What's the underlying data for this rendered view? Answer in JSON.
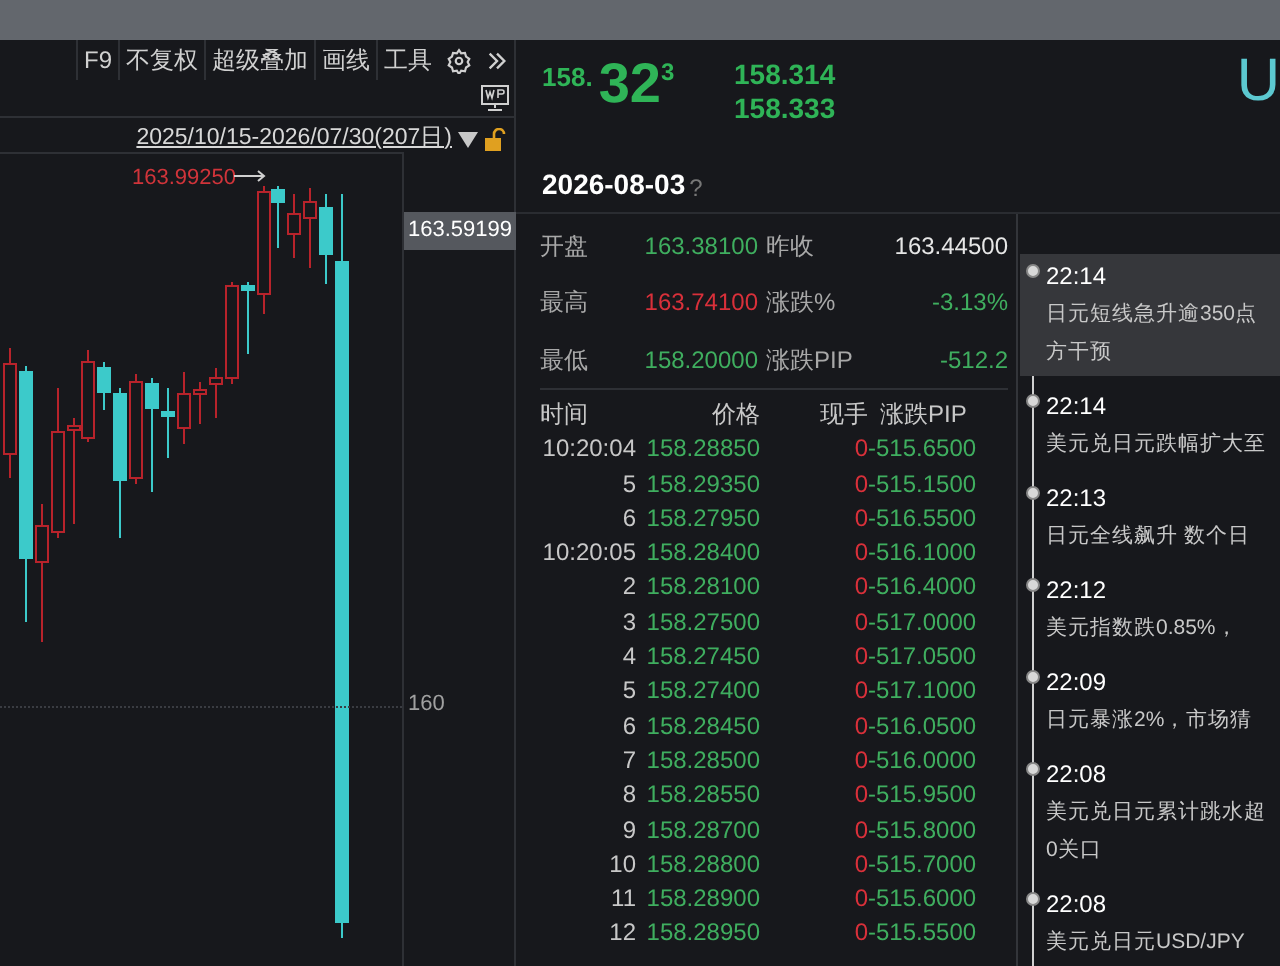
{
  "toolbar": {
    "items": [
      {
        "label": "F9"
      },
      {
        "label": "不复权"
      },
      {
        "label": "超级叠加"
      },
      {
        "label": "画线"
      },
      {
        "label": "工具"
      }
    ]
  },
  "chart": {
    "date_range": "2025/10/15-2026/07/30(207日)",
    "high_label": "163.99250",
    "price_tag": "163.59199",
    "axis_label": "160"
  },
  "quote": {
    "price_head": "158.",
    "price_big": "32",
    "price_sup": "3",
    "bid": "158.314",
    "ask": "158.333",
    "symbol": "U"
  },
  "date": {
    "text": "2026-08-03",
    "help": "?"
  },
  "stats": [
    {
      "label": "开盘",
      "value": "163.38100",
      "color": "#3fae5f"
    },
    {
      "label": "昨收",
      "value": "163.44500",
      "color": "#e6e6e6"
    },
    {
      "label": "最高",
      "value": "163.74100",
      "color": "#d9303a"
    },
    {
      "label": "涨跌%",
      "value": "-3.13%",
      "color": "#3fae5f"
    },
    {
      "label": "最低",
      "value": "158.20000",
      "color": "#3fae5f"
    },
    {
      "label": "涨跌PIP",
      "value": "-512.2",
      "color": "#3fae5f"
    }
  ],
  "ticks": {
    "columns": [
      "时间",
      "价格",
      "现手",
      "涨跌PIP"
    ],
    "rows": [
      {
        "time": "10:20:04",
        "price": "158.28850",
        "volume": "0",
        "change": "-515.6500"
      },
      {
        "time": "5",
        "price": "158.29350",
        "volume": "0",
        "change": "-515.1500"
      },
      {
        "time": "6",
        "price": "158.27950",
        "volume": "0",
        "change": "-516.5500"
      },
      {
        "time": "10:20:05",
        "price": "158.28400",
        "volume": "0",
        "change": "-516.1000"
      },
      {
        "time": "2",
        "price": "158.28100",
        "volume": "0",
        "change": "-516.4000"
      },
      {
        "time": "3",
        "price": "158.27500",
        "volume": "0",
        "change": "-517.0000"
      },
      {
        "time": "4",
        "price": "158.27450",
        "volume": "0",
        "change": "-517.0500"
      },
      {
        "time": "5",
        "price": "158.27400",
        "volume": "0",
        "change": "-517.1000"
      },
      {
        "time": "6",
        "price": "158.28450",
        "volume": "0",
        "change": "-516.0500"
      },
      {
        "time": "7",
        "price": "158.28500",
        "volume": "0",
        "change": "-516.0000"
      },
      {
        "time": "8",
        "price": "158.28550",
        "volume": "0",
        "change": "-515.9500"
      },
      {
        "time": "9",
        "price": "158.28700",
        "volume": "0",
        "change": "-515.8000"
      },
      {
        "time": "10",
        "price": "158.28800",
        "volume": "0",
        "change": "-515.7000"
      },
      {
        "time": "11",
        "price": "158.28900",
        "volume": "0",
        "change": "-515.6000"
      },
      {
        "time": "12",
        "price": "158.28950",
        "volume": "0",
        "change": "-515.5500"
      }
    ]
  },
  "news": [
    {
      "time": "22:14",
      "lines": [
        "日元短线急升逾350点",
        "方干预"
      ],
      "selected": true
    },
    {
      "time": "22:14",
      "lines": [
        "美元兑日元跌幅扩大至"
      ],
      "selected": false
    },
    {
      "time": "22:13",
      "lines": [
        "日元全线飙升 数个日"
      ],
      "selected": false
    },
    {
      "time": "22:12",
      "lines": [
        "美元指数跌0.85%，"
      ],
      "selected": false
    },
    {
      "time": "22:09",
      "lines": [
        "日元暴涨2%，市场猜"
      ],
      "selected": false
    },
    {
      "time": "22:08",
      "lines": [
        "美元兑日元累计跳水超",
        "0关口"
      ],
      "selected": false
    },
    {
      "time": "22:08",
      "lines": [
        "美元兑日元USD/JPY"
      ],
      "selected": false
    }
  ]
}
